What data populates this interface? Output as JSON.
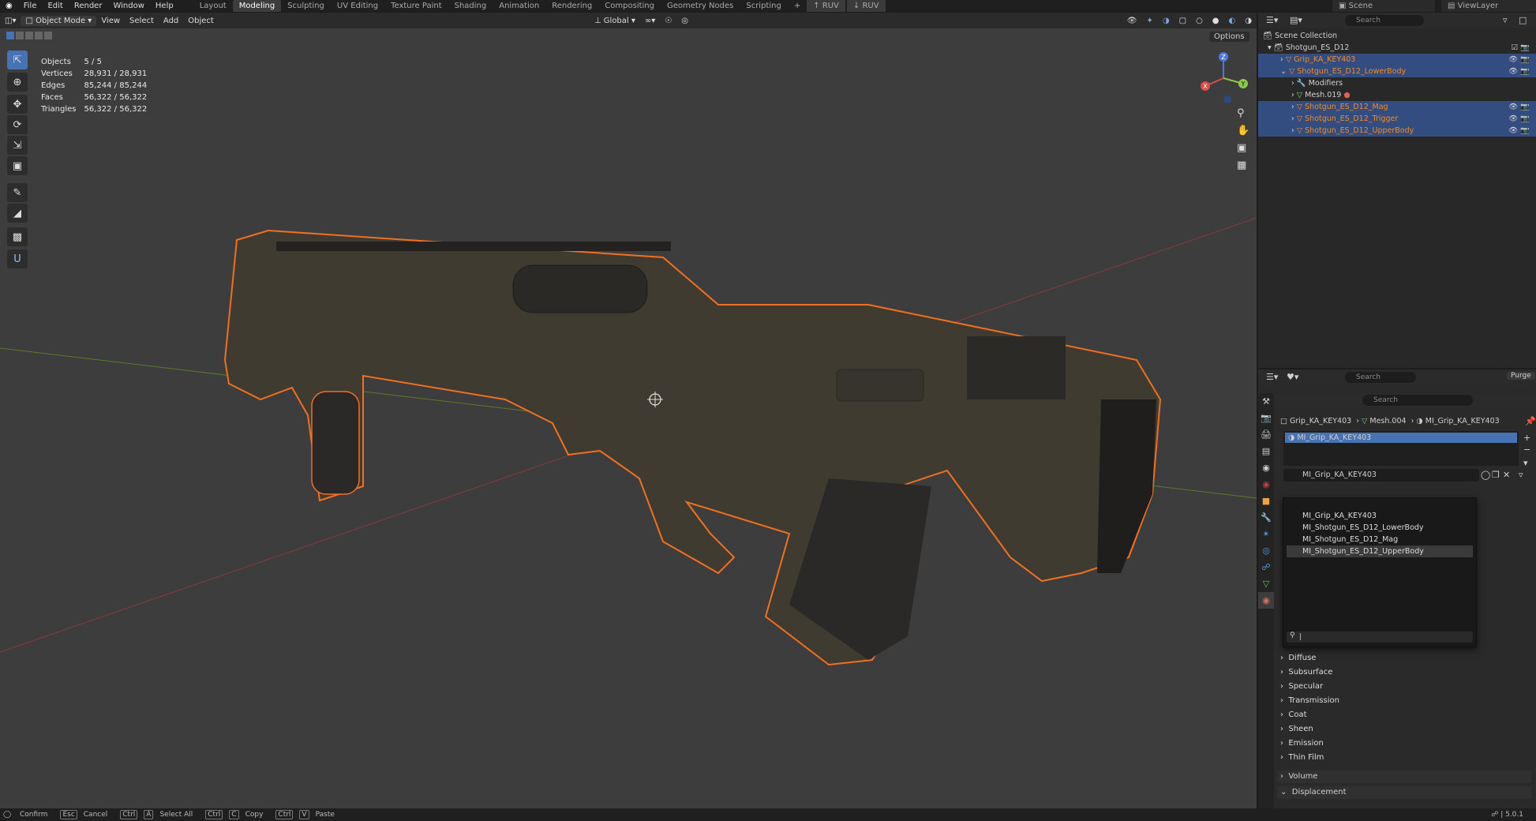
{
  "menubar": {
    "file": "File",
    "edit": "Edit",
    "render": "Render",
    "window": "Window",
    "help": "Help",
    "workspaces": [
      "Layout",
      "Modeling",
      "Sculpting",
      "UV Editing",
      "Texture Paint",
      "Shading",
      "Animation",
      "Rendering",
      "Compositing",
      "Geometry Nodes",
      "Scripting"
    ],
    "active_workspace": "Modeling",
    "ruv1": "RUV",
    "ruv2": "RUV",
    "scene": "Scene",
    "view_layer": "ViewLayer"
  },
  "viewport_header": {
    "mode": "Object Mode",
    "view": "View",
    "select": "Select",
    "add": "Add",
    "object": "Object",
    "transform": "Global",
    "options": "Options"
  },
  "stats": [
    {
      "label": "Objects",
      "value": "5 / 5"
    },
    {
      "label": "Vertices",
      "value": "28,931 / 28,931"
    },
    {
      "label": "Edges",
      "value": "85,244 / 85,244"
    },
    {
      "label": "Faces",
      "value": "56,322 / 56,322"
    },
    {
      "label": "Triangles",
      "value": "56,322 / 56,322"
    }
  ],
  "outliner": {
    "search_placeholder": "Search",
    "collection": "Scene Collection",
    "root": "Shotgun_ES_D12",
    "items": [
      {
        "name": "Grip_KA_KEY403",
        "selected": true
      },
      {
        "name": "Shotgun_ES_D12_LowerBody",
        "selected": true
      },
      {
        "name": "Modifiers",
        "selected": false
      },
      {
        "name": "Mesh.019",
        "selected": false
      },
      {
        "name": "Shotgun_ES_D12_Mag",
        "selected": true
      },
      {
        "name": "Shotgun_ES_D12_Trigger",
        "selected": true
      },
      {
        "name": "Shotgun_ES_D12_UpperBody",
        "selected": true
      }
    ]
  },
  "properties": {
    "search_placeholder": "Search",
    "purge": "Purge",
    "breadcrumb": [
      "Grip_KA_KEY403",
      "Mesh.004",
      "MI_Grip_KA_KEY403"
    ],
    "slot": "MI_Grip_KA_KEY403",
    "material_field": "MI_Grip_KA_KEY403",
    "sections": [
      "Diffuse",
      "Subsurface",
      "Specular",
      "Transmission",
      "Coat",
      "Sheen",
      "Emission",
      "Thin Film"
    ],
    "volume": "Volume",
    "displacement": "Displacement"
  },
  "material_dropdown": {
    "items": [
      "MI_Grip_KA_KEY403",
      "MI_Shotgun_ES_D12_LowerBody",
      "MI_Shotgun_ES_D12_Mag",
      "MI_Shotgun_ES_D12_UpperBody"
    ],
    "highlighted": "MI_Shotgun_ES_D12_UpperBody",
    "search_value": ""
  },
  "gizmo": {
    "x": "X",
    "y": "Y",
    "z": "Z"
  },
  "statusbar": {
    "confirm": "Confirm",
    "esc": "Esc",
    "cancel": "Cancel",
    "ctrl1": "Ctrl",
    "a": "A",
    "select_all": "Select All",
    "ctrl2": "Ctrl",
    "c": "C",
    "copy": "Copy",
    "ctrl3": "Ctrl",
    "v": "V",
    "paste": "Paste",
    "version": "5.0.1"
  },
  "colors": {
    "accent": "#4772b3",
    "selection_outline": "#f07020",
    "outliner_selected": "#334d80"
  }
}
